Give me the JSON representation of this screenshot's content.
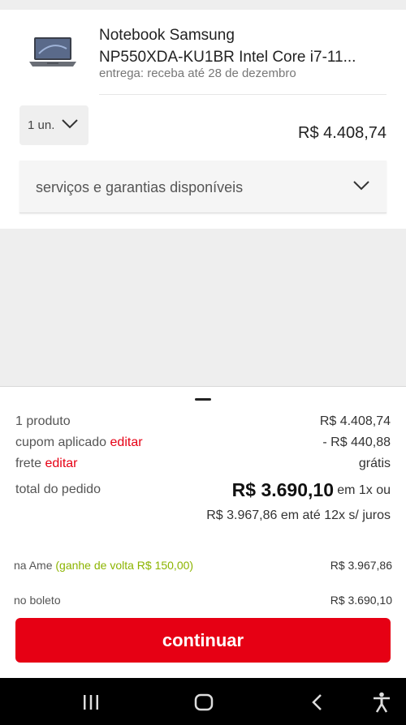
{
  "product": {
    "name_line1": "Notebook Samsung",
    "name_line2": "NP550XDA-KU1BR Intel Core i7-11...",
    "delivery": "entrega: receba até 28 de dezembro",
    "image_icon": "laptop-thumbnail",
    "quantity": "1 un.",
    "price": "R$ 4.408,74"
  },
  "services": {
    "label": "serviços e garantias disponíveis",
    "icon": "chevron-down-icon"
  },
  "summary": {
    "products_label": "1 produto",
    "products_value": "R$ 4.408,74",
    "coupon_label": "cupom aplicado",
    "coupon_edit": "editar",
    "coupon_value": "- R$ 440,88",
    "shipping_label": "frete",
    "shipping_edit": "editar",
    "shipping_value": "grátis",
    "total_label": "total do pedido",
    "total_value": "R$ 3.690,10",
    "total_suffix": "em 1x ou",
    "installments": "R$ 3.967,86 em até 12x s/ juros",
    "ame_label": "na Ame",
    "ame_cashback": "(ganhe de volta R$ 150,00)",
    "ame_value": "R$ 3.967,86",
    "boleto_label": "no boleto",
    "boleto_value": "R$ 3.690,10",
    "continue_label": "continuar"
  },
  "colors": {
    "brand_red": "#e60014",
    "green": "#8cb400"
  },
  "navbar": {
    "icons": [
      "recent-apps-icon",
      "home-icon",
      "back-icon",
      "accessibility-icon"
    ]
  }
}
